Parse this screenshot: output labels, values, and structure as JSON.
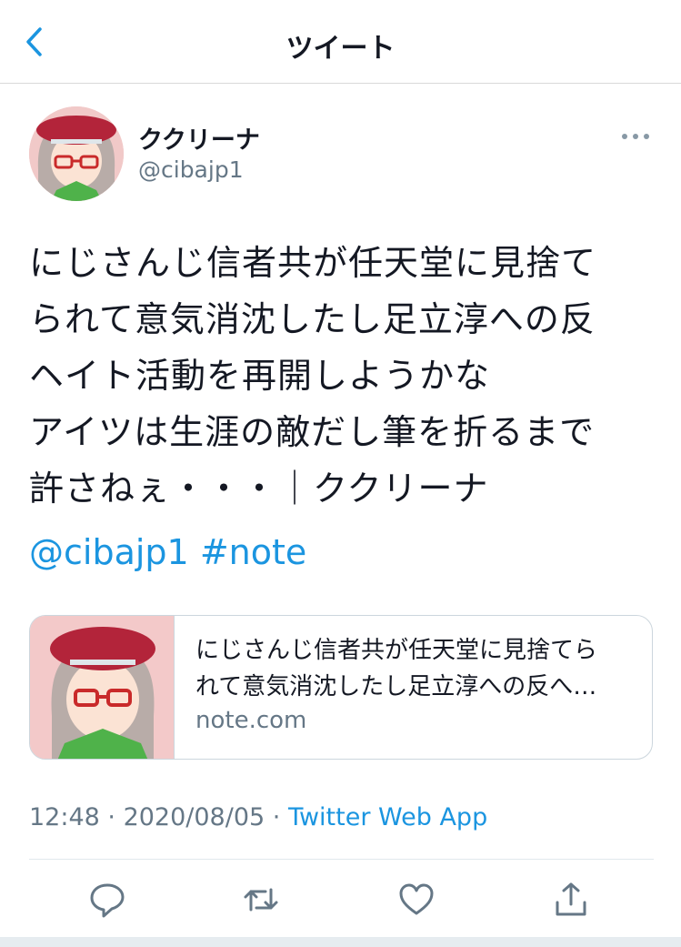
{
  "header": {
    "title": "ツイート"
  },
  "author": {
    "display_name": "ククリーナ",
    "handle": "@cibajp1"
  },
  "tweet": {
    "text": "にじさんじ信者共が任天堂に見捨て\nられて意気消沈したし足立淳への反\nヘイト活動を再開しようかな\nアイツは生涯の敵だし筆を折るまで\n許さねぇ・・・｜ククリーナ",
    "mention": "@cibajp1",
    "hashtag": "#note"
  },
  "card": {
    "title": "にじさんじ信者共が任天堂に見捨てら\nれて意気消沈したし足立淳への反へ…",
    "domain": "note.com"
  },
  "meta": {
    "time": "12:48",
    "separator1": " · ",
    "date": "2020/08/05",
    "separator2": " · ",
    "source": "Twitter Web App"
  },
  "icons": {
    "back": "chevron-left-icon",
    "more": "more-dots-icon",
    "reply": "reply-icon",
    "retweet": "retweet-icon",
    "like": "heart-icon",
    "share": "share-icon"
  },
  "colors": {
    "link": "#1b95e0",
    "secondary_text": "#657786",
    "primary_text": "#141823"
  }
}
